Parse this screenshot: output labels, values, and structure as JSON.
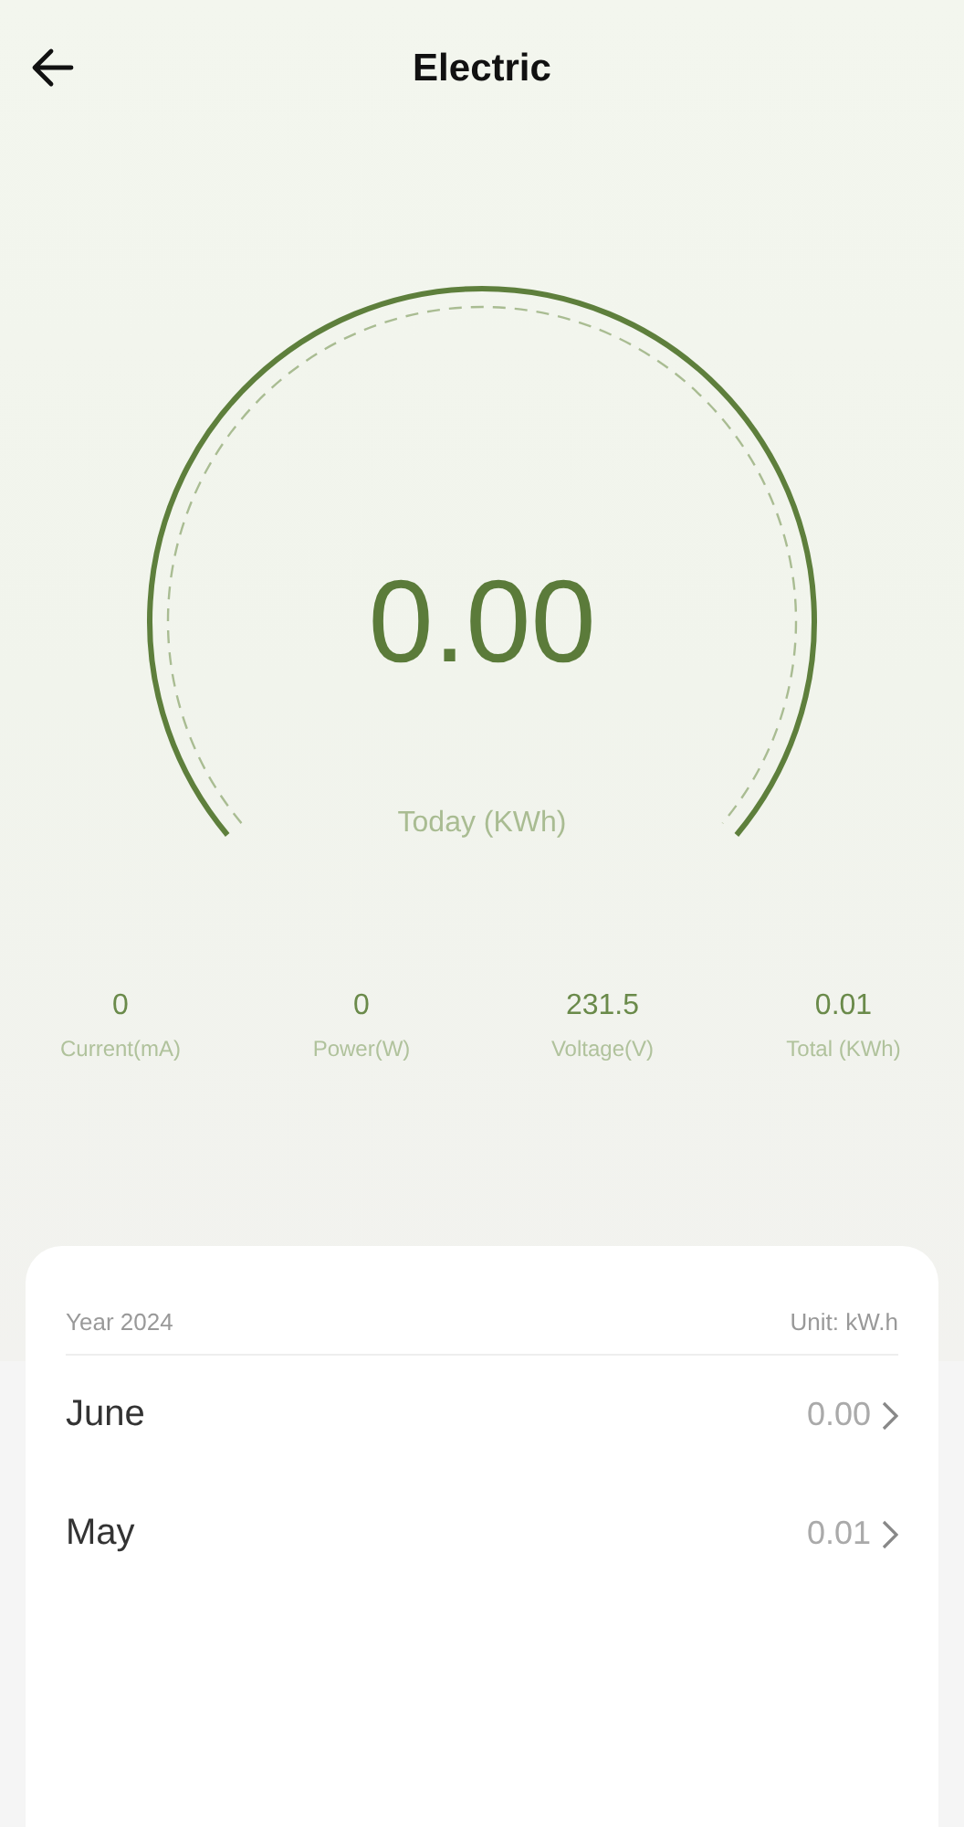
{
  "header": {
    "title": "Electric"
  },
  "gauge": {
    "value": "0.00",
    "label": "Today (KWh)"
  },
  "stats": [
    {
      "value": "0",
      "label": "Current(mA)"
    },
    {
      "value": "0",
      "label": "Power(W)"
    },
    {
      "value": "231.5",
      "label": "Voltage(V)"
    },
    {
      "value": "0.01",
      "label": "Total (KWh)"
    }
  ],
  "history": {
    "year": "Year 2024",
    "unit": "Unit: kW.h",
    "months": [
      {
        "name": "June",
        "value": "0.00"
      },
      {
        "name": "May",
        "value": "0.01"
      }
    ]
  }
}
